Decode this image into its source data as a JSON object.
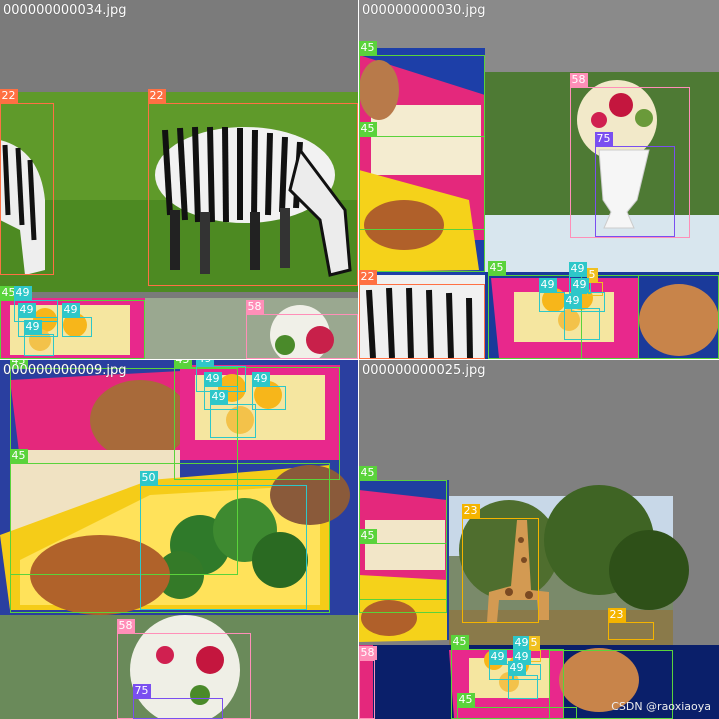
{
  "tiles": [
    {
      "filename": "000000000034.jpg"
    },
    {
      "filename": "000000000030.jpg"
    },
    {
      "filename": "000000000009.jpg"
    },
    {
      "filename": "000000000025.jpg"
    }
  ],
  "class_colors": {
    "22": "#ff7043",
    "23": "#f4b400",
    "45": "#5ad33b",
    "49": "#2ec7c9",
    "5": "#f0c020",
    "50": "#2ec7c9",
    "58": "#ff8fb8",
    "75": "#7a4ff0"
  },
  "labels": {
    "zebra": "22",
    "giraffe": "23",
    "bowl": "45",
    "orange": "49",
    "five": "5",
    "broccoli": "50",
    "pottedplant": "58",
    "vase": "75"
  },
  "watermark": "CSDN @raoxiaoya"
}
